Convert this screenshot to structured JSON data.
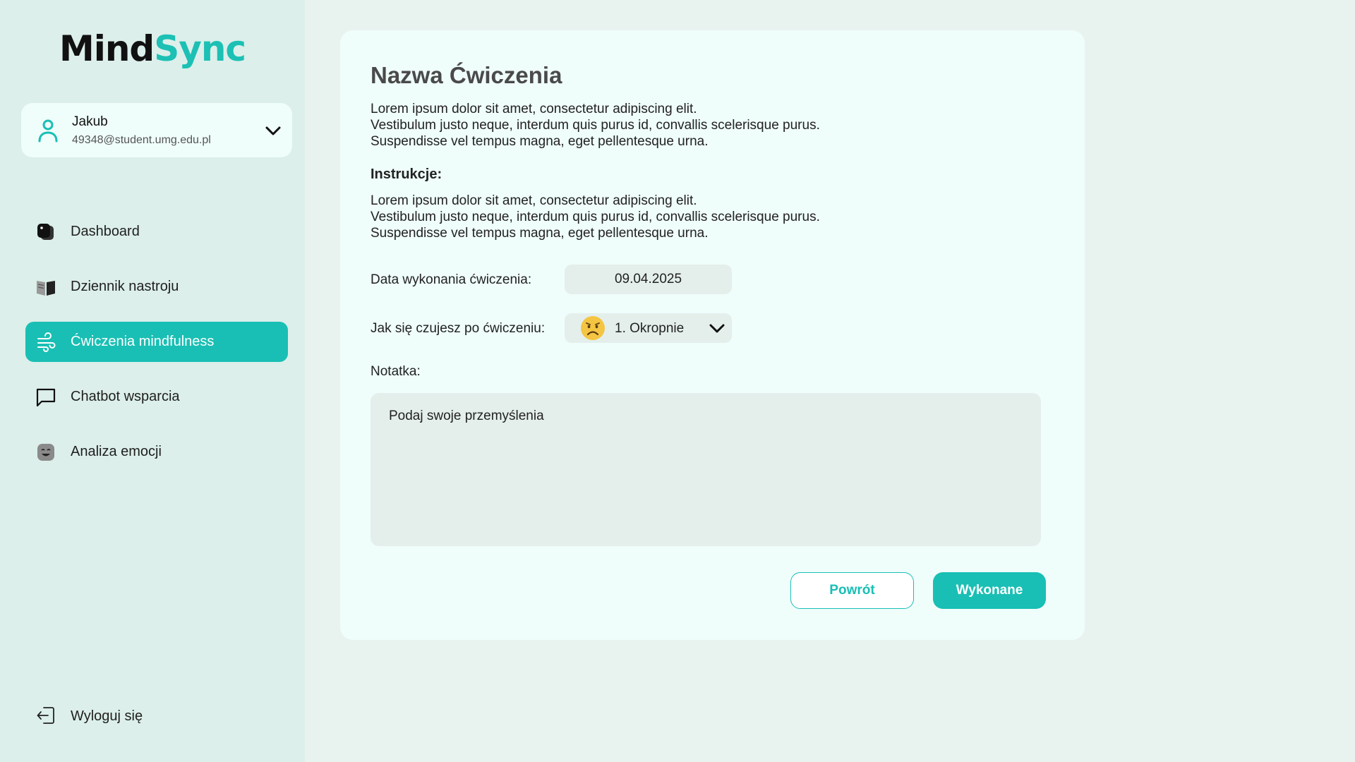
{
  "brand": {
    "part1": "Mind",
    "part2": "Sync"
  },
  "user": {
    "name": "Jakub",
    "email": "49348@student.umg.edu.pl",
    "icon": "user-icon"
  },
  "nav": {
    "items": [
      {
        "label": "Dashboard",
        "icon": "dashboard-icon",
        "active": false
      },
      {
        "label": "Dziennik nastroju",
        "icon": "book-icon",
        "active": false
      },
      {
        "label": "Ćwiczenia mindfulness",
        "icon": "wind-icon",
        "active": true
      },
      {
        "label": "Chatbot wsparcia",
        "icon": "chat-icon",
        "active": false
      },
      {
        "label": "Analiza emocji",
        "icon": "emotion-icon",
        "active": false
      }
    ],
    "logout": {
      "label": "Wyloguj się",
      "icon": "logout-icon"
    }
  },
  "exercise": {
    "title": "Nazwa Ćwiczenia",
    "description": [
      "Lorem ipsum dolor sit amet, consectetur adipiscing elit.",
      "Vestibulum justo neque, interdum quis purus id, convallis scelerisque purus.",
      "Suspendisse vel tempus magna, eget pellentesque urna."
    ],
    "instructions_heading": "Instrukcje:",
    "instructions": [
      "Lorem ipsum dolor sit amet, consectetur adipiscing elit.",
      "Vestibulum justo neque, interdum quis purus id, convallis scelerisque purus.",
      "Suspendisse vel tempus magna, eget pellentesque urna."
    ]
  },
  "form": {
    "date_label": "Data wykonania ćwiczenia:",
    "date_value": "09.04.2025",
    "mood_label": "Jak się czujesz po ćwiczeniu:",
    "mood_value": "1. Okropnie",
    "mood_icon": "sad-face-emoji",
    "note_label": "Notatka:",
    "note_placeholder": "Podaj swoje przemyślenia",
    "note_value": ""
  },
  "actions": {
    "back_label": "Powrót",
    "done_label": "Wykonane"
  },
  "colors": {
    "accent": "#19bfb4",
    "sidebar_bg": "#dcefea",
    "page_bg": "#e8f3f0",
    "card_bg": "#effdfb",
    "field_bg": "#e4efec"
  }
}
